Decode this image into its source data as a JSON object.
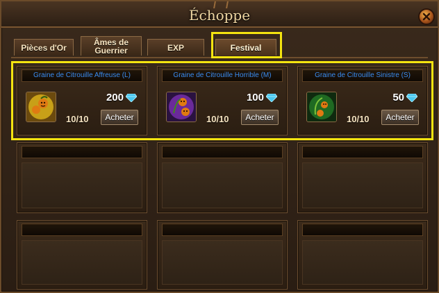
{
  "window": {
    "title": "Échoppe",
    "close_icon": "close-icon"
  },
  "tabs": [
    {
      "label": "Pièces d'Or",
      "active": false
    },
    {
      "label": "Âmes de Guerrier",
      "active": false
    },
    {
      "label": "EXP",
      "active": false
    },
    {
      "label": "Festival",
      "active": true
    }
  ],
  "items": [
    {
      "name": "Graine de Citrouille Affreuse (L)",
      "price": "200",
      "currency_icon": "diamond-icon",
      "stock": "10/10",
      "buy_label": "Acheter",
      "icon": "pumpkin-seed-large-icon",
      "icon_bg": "#c8a018"
    },
    {
      "name": "Graine de Citrouille Horrible (M)",
      "price": "100",
      "currency_icon": "diamond-icon",
      "stock": "10/10",
      "buy_label": "Acheter",
      "icon": "pumpkin-seed-medium-icon",
      "icon_bg": "#6a2a9a"
    },
    {
      "name": "Graine de Citrouille Sinistre (S)",
      "price": "50",
      "currency_icon": "diamond-icon",
      "stock": "10/10",
      "buy_label": "Acheter",
      "icon": "pumpkin-seed-small-icon",
      "icon_bg": "#1f6a22"
    }
  ],
  "colors": {
    "highlight": "#f4e410",
    "item_name": "#3a8cf0",
    "diamond": "#49c8f0"
  }
}
